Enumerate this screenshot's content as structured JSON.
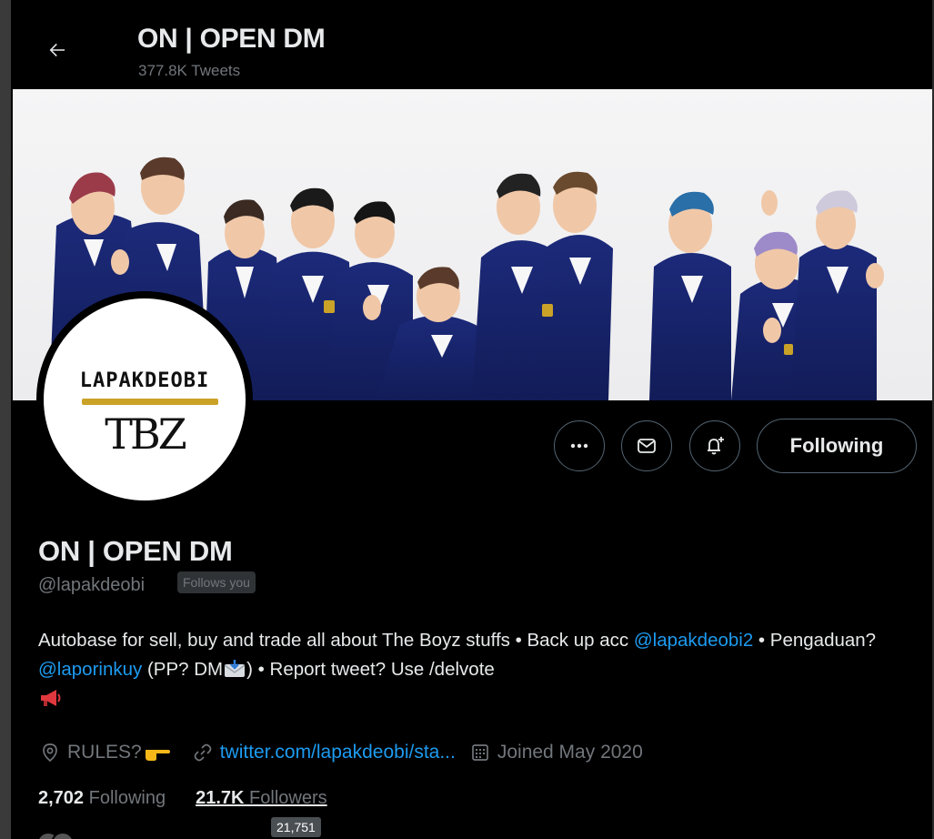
{
  "header": {
    "title": "ON | OPEN DM",
    "tweet_count": "377.8K Tweets"
  },
  "avatar": {
    "logo_top": "LAPAKDEOBI",
    "logo_bottom": "TBZ"
  },
  "actions": {
    "following_label": "Following"
  },
  "profile": {
    "name": "ON | OPEN DM",
    "handle": "@lapakdeobi",
    "follows_badge": "Follows you"
  },
  "bio": {
    "part1": "Autobase for sell, buy and trade all about The Boyz stuffs • Back up acc ",
    "mention1": "@lapakdeobi2",
    "part2": " • Pengaduan? ",
    "mention2": "@laporinkuy",
    "part3": " (PP? DM",
    "part4": ") • Report tweet? Use /delvote"
  },
  "meta": {
    "location": "RULES?",
    "website": "twitter.com/lapakdeobi/sta...",
    "joined": "Joined May 2020"
  },
  "stats": {
    "following_count": "2,702",
    "following_label": " Following",
    "followers_count": "21.7K",
    "followers_label": " Followers"
  },
  "tooltip": {
    "value": "21,751"
  },
  "colors": {
    "background": "#000000",
    "text": "#e7e9ea",
    "muted": "#71767b",
    "link": "#1d9bf0",
    "border": "#536471"
  }
}
